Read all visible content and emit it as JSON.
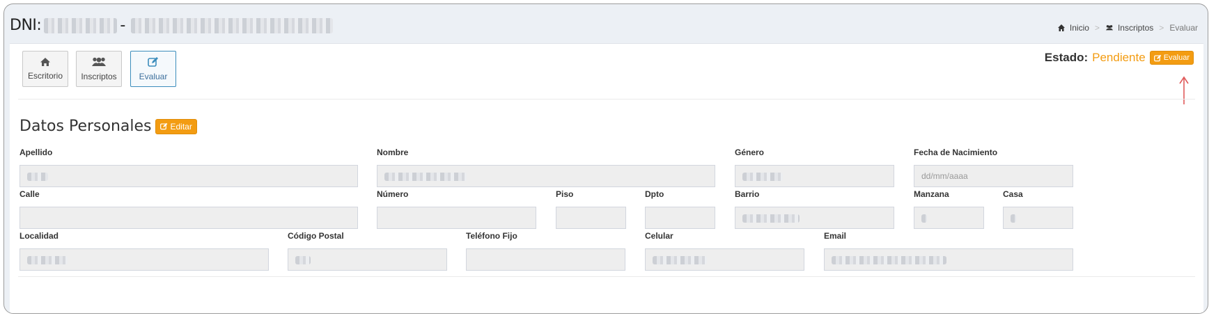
{
  "header": {
    "dni_label": "DNI:",
    "dni_separator": "-",
    "breadcrumb": {
      "home": "Inicio",
      "inscriptos": "Inscriptos",
      "current": "Evaluar"
    }
  },
  "nav": {
    "escritorio": "Escritorio",
    "inscriptos": "Inscriptos",
    "evaluar": "Evaluar"
  },
  "estado": {
    "label": "Estado:",
    "value": "Pendiente",
    "button": "Evaluar"
  },
  "datos": {
    "title": "Datos Personales",
    "edit_button": "Editar",
    "fields": {
      "apellido": "Apellido",
      "nombre": "Nombre",
      "genero": "Género",
      "fecha_nacimiento": "Fecha de Nacimiento",
      "fecha_placeholder": "dd/mm/aaaa",
      "calle": "Calle",
      "numero": "Número",
      "piso": "Piso",
      "dpto": "Dpto",
      "barrio": "Barrio",
      "manzana": "Manzana",
      "casa": "Casa",
      "localidad": "Localidad",
      "codigo_postal": "Código Postal",
      "telefono_fijo": "Teléfono Fijo",
      "celular": "Celular",
      "email": "Email"
    }
  },
  "colors": {
    "accent_orange": "#f39c12",
    "active_blue": "#3c8dbc",
    "arrow_red": "#e05a5a"
  }
}
